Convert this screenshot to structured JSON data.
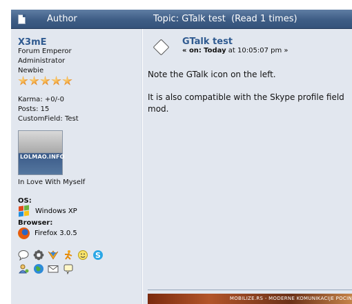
{
  "header": {
    "author_label": "Author",
    "topic_label": "Topic: GTalk test  (Read 1 times)"
  },
  "poster": {
    "name": "X3mE",
    "rank": "Forum Emperor",
    "group": "Administrator",
    "title": "Newbie",
    "star_count": 5,
    "karma": "Karma: +0/-0",
    "posts": "Posts: 15",
    "custom_field": "CustomField: Test",
    "avatar_text": "LOLMAO.INFO",
    "personal_text": "In Love With Myself",
    "os_label": "OS:",
    "os_value": "Windows XP",
    "browser_label": "Browser:",
    "browser_value": "Firefox 3.0.5",
    "contact_icons_row1": [
      "gtalk-icon",
      "icq-icon",
      "aim-icon",
      "msn-icon",
      "yahoo-icon",
      "skype-icon"
    ],
    "contact_icons_row2": [
      "profile-icon",
      "website-icon",
      "email-icon",
      "pm-icon"
    ]
  },
  "message": {
    "title": "GTalk test",
    "date_prefix": "« on:",
    "date_today": "Today",
    "date_time": "at 10:05:07 pm »",
    "body": [
      "Note the GTalk icon on the left.",
      "It is also compatible with the Skype profile field mod."
    ],
    "signature_text": "MOBILIZE.RS - MODERNE KOMUNIKACIJE POCIN"
  },
  "colors": {
    "header_bg": "#3e5d85",
    "panel_bg": "#e2e7ef",
    "link": "#2f5a90"
  }
}
